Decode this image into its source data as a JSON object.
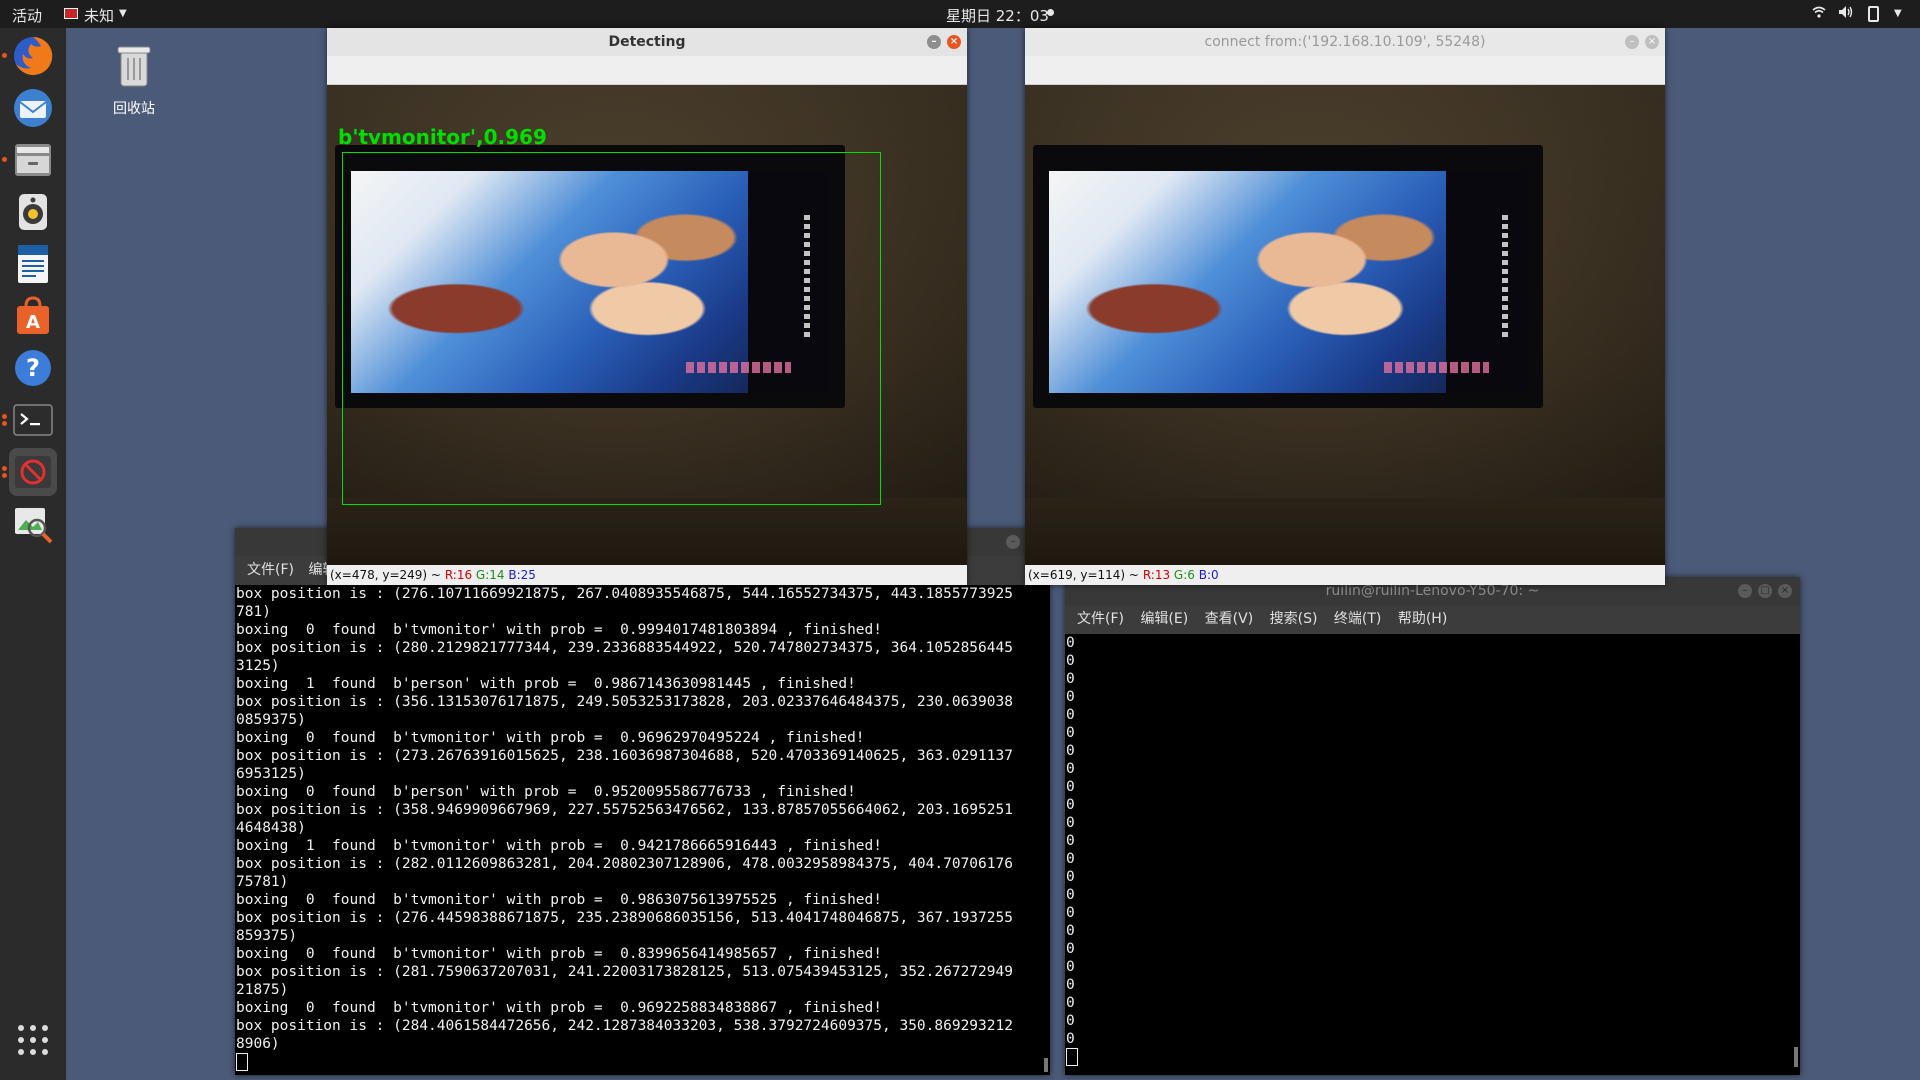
{
  "topbar": {
    "activities": "活动",
    "ime_label": "未知",
    "clock": "星期日 22：03"
  },
  "dock": {
    "items": [
      {
        "name": "firefox",
        "icon": "firefox-icon"
      },
      {
        "name": "thunderbird",
        "icon": "mail-icon"
      },
      {
        "name": "files",
        "icon": "file-cabinet-icon"
      },
      {
        "name": "rhythmbox",
        "icon": "speaker-icon"
      },
      {
        "name": "libreoffice-writer",
        "icon": "document-icon"
      },
      {
        "name": "software",
        "icon": "shopping-bag-icon"
      },
      {
        "name": "help",
        "icon": "question-icon"
      },
      {
        "name": "terminal",
        "icon": "terminal-icon"
      },
      {
        "name": "blocked-app",
        "icon": "no-entry-icon"
      },
      {
        "name": "image-viewer",
        "icon": "image-viewer-icon"
      }
    ],
    "show_apps_icon": "grid-icon"
  },
  "desktop": {
    "trash_label": "回收站"
  },
  "detect_window": {
    "title": "Detecting",
    "label": "b'tvmonitor',0.969",
    "status_xy": "(x=478, y=249) ~",
    "status_r": "R:16",
    "status_g": "G:14",
    "status_b": "B:25"
  },
  "connect_window": {
    "title": "connect from:('192.168.10.109', 55248)",
    "status_xy": "(x=619, y=114) ~",
    "status_r": "R:13",
    "status_g": "G:6",
    "status_b": "B:0"
  },
  "left_terminal": {
    "menu": [
      "文件(F)",
      "编辑"
    ],
    "lines": [
      "box position is : (276.10711669921875, 267.0408935546875, 544.16552734375, 443.1855773925",
      "781)",
      "boxing  0  found  b'tvmonitor' with prob =  0.9994017481803894 , finished!",
      "box position is : (280.2129821777344, 239.2336883544922, 520.747802734375, 364.1052856445",
      "3125)",
      "boxing  1  found  b'person' with prob =  0.9867143630981445 , finished!",
      "box position is : (356.13153076171875, 249.5053253173828, 203.02337646484375, 230.0639038",
      "0859375)",
      "boxing  0  found  b'tvmonitor' with prob =  0.96962970495224 , finished!",
      "box position is : (273.26763916015625, 238.16036987304688, 520.4703369140625, 363.0291137",
      "6953125)",
      "boxing  0  found  b'person' with prob =  0.9520095586776733 , finished!",
      "box position is : (358.9469909667969, 227.55752563476562, 133.87857055664062, 203.1695251",
      "4648438)",
      "boxing  1  found  b'tvmonitor' with prob =  0.9421786665916443 , finished!",
      "box position is : (282.0112609863281, 204.20802307128906, 478.0032958984375, 404.70706176",
      "75781)",
      "boxing  0  found  b'tvmonitor' with prob =  0.9863075613975525 , finished!",
      "box position is : (276.44598388671875, 235.23890686035156, 513.4041748046875, 367.1937255",
      "859375)",
      "boxing  0  found  b'tvmonitor' with prob =  0.8399656414985657 , finished!",
      "box position is : (281.7590637207031, 241.22003173828125, 513.075439453125, 352.267272949",
      "21875)",
      "boxing  0  found  b'tvmonitor' with prob =  0.9692258834838867 , finished!",
      "box position is : (284.4061584472656, 242.1287384033203, 538.3792724609375, 350.869293212",
      "8906)"
    ]
  },
  "right_terminal": {
    "title": "ruilin@ruilin-Lenovo-Y50-70: ~",
    "menu": [
      "文件(F)",
      "编辑(E)",
      "查看(V)",
      "搜索(S)",
      "终端(T)",
      "帮助(H)"
    ],
    "lines": [
      "0",
      "0",
      "0",
      "0",
      "0",
      "0",
      "0",
      "0",
      "0",
      "0",
      "0",
      "0",
      "0",
      "0",
      "0",
      "0",
      "0",
      "0",
      "0",
      "0",
      "0",
      "0",
      "0"
    ]
  }
}
